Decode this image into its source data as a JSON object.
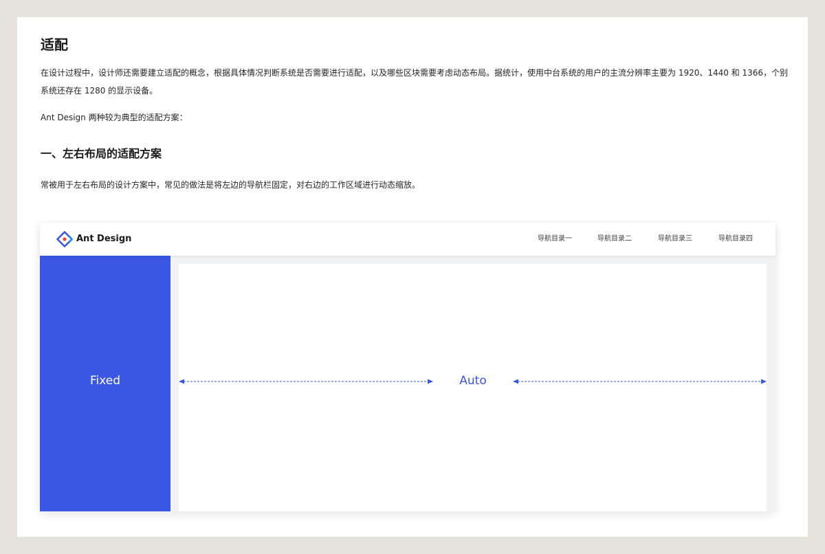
{
  "doc": {
    "title": "适配",
    "intro": "在设计过程中，设计师还需要建立适配的概念，根据具体情况判断系统是否需要进行适配，以及哪些区块需要考虑动态布局。据统计，使用中台系统的用户的主流分辨率主要为 1920、1440 和 1366，个别系统还存在 1280 的显示设备。",
    "schemes_intro": "Ant Design 两种较为典型的适配方案：",
    "section_title": "一、左右布局的适配方案",
    "section_text": "常被用于左右布局的设计方案中，常见的做法是将左边的导航栏固定，对右边的工作区域进行动态缩放。"
  },
  "illustration": {
    "brand": {
      "name": "Ant Design",
      "icon": "ant-design-logo-icon"
    },
    "nav_items": [
      "导航目录一",
      "导航目录二",
      "导航目录三",
      "导航目录四"
    ],
    "sidebar_label": "Fixed",
    "content_label": "Auto",
    "colors": {
      "accent": "#3a56e4",
      "logo_red": "#f04134",
      "canvas_bg": "#f0f2f5",
      "page_bg": "#e6e3dd"
    }
  }
}
